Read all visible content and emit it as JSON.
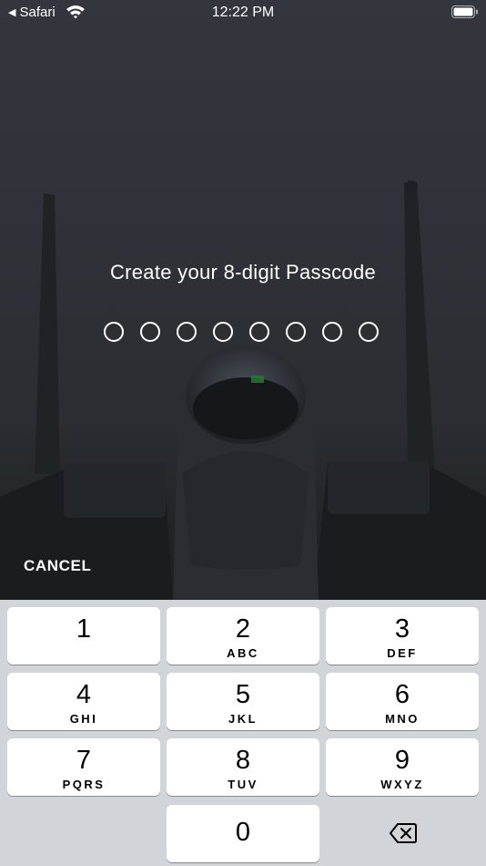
{
  "status_bar": {
    "back_app": "Safari",
    "time": "12:22 PM"
  },
  "title": "Create your 8-digit Passcode",
  "passcode": {
    "length": 8,
    "entered": 0
  },
  "cancel_label": "CANCEL",
  "keys": [
    {
      "digit": "1",
      "letters": ""
    },
    {
      "digit": "2",
      "letters": "ABC"
    },
    {
      "digit": "3",
      "letters": "DEF"
    },
    {
      "digit": "4",
      "letters": "GHI"
    },
    {
      "digit": "5",
      "letters": "JKL"
    },
    {
      "digit": "6",
      "letters": "MNO"
    },
    {
      "digit": "7",
      "letters": "PQRS"
    },
    {
      "digit": "8",
      "letters": "TUV"
    },
    {
      "digit": "9",
      "letters": "WXYZ"
    },
    {
      "digit": "0",
      "letters": ""
    }
  ],
  "icons": {
    "back": "back-triangle-icon",
    "wifi": "wifi-icon",
    "battery": "battery-icon",
    "delete": "backspace-icon"
  },
  "colors": {
    "keypad_bg": "#d1d4d9",
    "key_bg": "#ffffff",
    "text_on_photo": "#ffffff"
  }
}
